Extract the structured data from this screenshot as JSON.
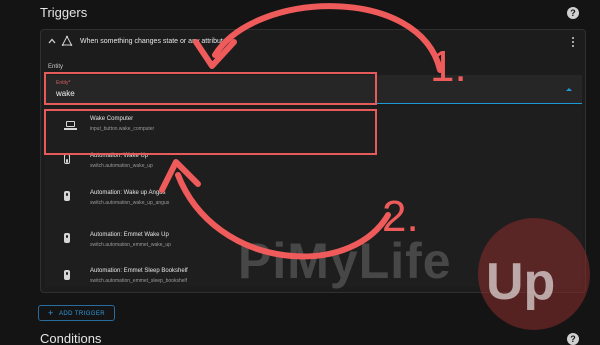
{
  "sections": {
    "triggers_title": "Triggers",
    "conditions_title": "Conditions",
    "help_glyph": "?"
  },
  "trigger_card": {
    "title": "When something changes state or any attribute",
    "entity_label": "Entity",
    "field_label": "Entity*",
    "field_value": "wake"
  },
  "options": [
    {
      "title": "Wake Computer",
      "subtitle": "input_button.wake_computer",
      "icon": "laptop-icon"
    },
    {
      "title": "Automation: Wake Up",
      "subtitle": "switch.automation_wake_up",
      "icon": "toggle-icon"
    },
    {
      "title": "Automation: Wake up Angus",
      "subtitle": "switch.automation_wake_up_angus",
      "icon": "toggle-icon"
    },
    {
      "title": "Automation: Emmet Wake Up",
      "subtitle": "switch.automation_emmet_wake_up",
      "icon": "toggle-icon"
    },
    {
      "title": "Automation: Emmet Sleep Bookshelf",
      "subtitle": "switch.automation_emmet_sleep_bookshelf",
      "icon": "toggle-icon"
    }
  ],
  "add_trigger": {
    "label": "ADD TRIGGER",
    "plus": "+"
  },
  "annotations": {
    "step1": "1.",
    "step2": "2.",
    "color": "#ef5b5b"
  },
  "watermark": {
    "text": "PiMyLife",
    "badge": "Up"
  }
}
